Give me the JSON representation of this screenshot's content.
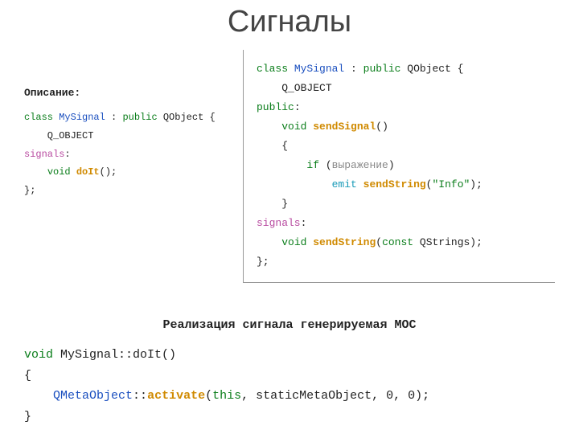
{
  "title": "Сигналы",
  "left": {
    "label": "Описание:",
    "code": {
      "l1": {
        "kw1": "class",
        "name": "MySignal",
        "colon": " : ",
        "kw2": "public",
        "base": " QObject {"
      },
      "l2": "    Q_OBJECT",
      "l3": {
        "sig": "signals",
        "colon": ":"
      },
      "l4": {
        "pad": "    ",
        "ret": "void",
        "sp": " ",
        "fn": "doIt",
        "rest": "();"
      },
      "l5": "};"
    }
  },
  "right": {
    "code": {
      "l1": {
        "kw1": "class",
        "name": "MySignal",
        "colon": " : ",
        "kw2": "public",
        "base": " QObject {"
      },
      "l2": "    Q_OBJECT",
      "l3": {
        "kw": "public",
        "colon": ":"
      },
      "l4": {
        "pad": "    ",
        "ret": "void",
        "sp": " ",
        "fn": "sendSignal",
        "rest": "()"
      },
      "l5": "    {",
      "l6": {
        "pad": "        ",
        "kw": "if",
        "rest": " (",
        "expr": "выражение",
        "close": ")"
      },
      "l7": {
        "pad": "            ",
        "emit": "emit",
        "sp": " ",
        "fn": "sendString",
        "open": "(",
        "str": "\"Info\"",
        "close": ");"
      },
      "l8": "    }",
      "l9": {
        "sig": "signals",
        "colon": ":"
      },
      "l10": {
        "pad": "    ",
        "ret": "void",
        "sp": " ",
        "fn": "sendString",
        "open": "(",
        "kw": "const",
        "rest": " QStrings);"
      },
      "l11": "};"
    }
  },
  "bottom": {
    "heading": "Реализация сигнала генерируемая MOC",
    "code": {
      "l1": {
        "ret": "void",
        "rest": " MySignal::doIt()"
      },
      "l2": "{",
      "l3": {
        "pad": "    ",
        "cls": "QMetaObject",
        "sep": "::",
        "fn": "activate",
        "open": "(",
        "kw": "this",
        "rest": ", staticMetaObject, 0, 0);"
      },
      "l4": "}"
    }
  }
}
